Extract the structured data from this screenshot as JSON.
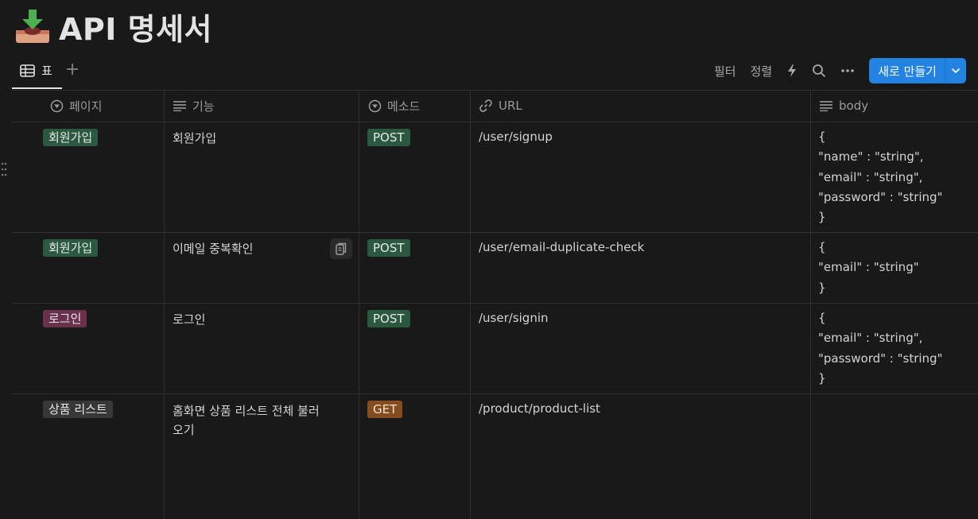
{
  "page": {
    "title": "API 명세서",
    "icon": "inbox-download-icon"
  },
  "views": {
    "active_tab": "표",
    "add_icon": "plus-icon"
  },
  "toolbar": {
    "filter": "필터",
    "sort": "정렬",
    "automation_icon": "lightning-icon",
    "search_icon": "search-icon",
    "more_icon": "more-icon",
    "new_button": "새로 만들기"
  },
  "columns": [
    {
      "label": "페이지",
      "icon": "select-icon"
    },
    {
      "label": "기능",
      "icon": "text-icon"
    },
    {
      "label": "메소드",
      "icon": "select-icon"
    },
    {
      "label": "URL",
      "icon": "link-icon"
    },
    {
      "label": "body",
      "icon": "text-icon"
    }
  ],
  "rows": [
    {
      "page": "회원가입",
      "feature": "회원가입",
      "method": "POST",
      "url": "/user/signup",
      "body": [
        "{",
        "\"name\" : \"string\",",
        "\"email\" : \"string\",",
        "\"password\" : \"string\"",
        "}"
      ]
    },
    {
      "page": "회원가입",
      "feature": "이메일 중복확인",
      "method": "POST",
      "url": "/user/email-duplicate-check",
      "body": [
        "{",
        "\"email\" : \"string\"",
        "}"
      ]
    },
    {
      "page": "로그인",
      "feature": "로그인",
      "method": "POST",
      "url": "/user/signin",
      "body": [
        "{",
        "\"email\" : \"string\",",
        "\"password\" : \"string\"",
        "}"
      ]
    },
    {
      "page": "상품 리스트",
      "feature": "홈화면 상품 리스트 전체 불러",
      "feature_line2": "오기",
      "method": "GET",
      "url": "/product/product-list",
      "body": []
    }
  ],
  "colors": {
    "background": "#191919",
    "accent": "#2383e2",
    "tag_green": "#2b593f",
    "tag_pink": "#69314c",
    "tag_gray": "#373737",
    "tag_orange": "#854c1d"
  }
}
